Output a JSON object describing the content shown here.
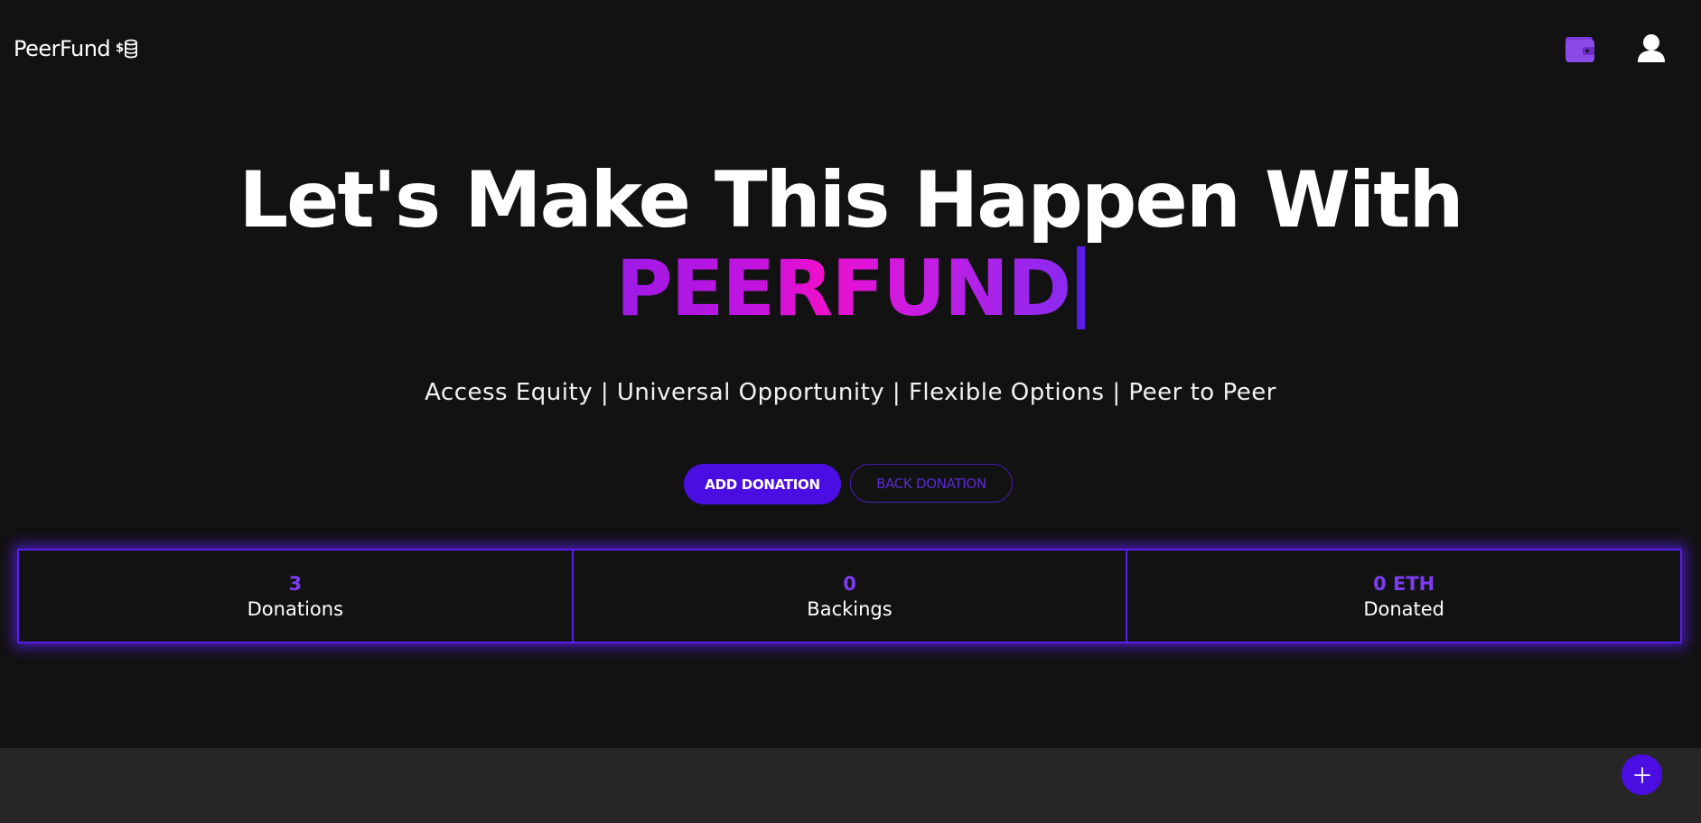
{
  "header": {
    "brand": "PeerFund",
    "brand_icon": "coins-icon",
    "wallet_icon": "wallet-icon",
    "user_icon": "user-icon"
  },
  "hero": {
    "title": "Let's Make This Happen With",
    "brand_text": "PEERFUND",
    "tagline": "Access Equity | Universal Opportunity | Flexible Options | Peer to Peer"
  },
  "actions": {
    "add_label": "ADD DONATION",
    "back_label": "BACK DONATION"
  },
  "stats": [
    {
      "value": "3",
      "label": "Donations"
    },
    {
      "value": "0",
      "label": "Backings"
    },
    {
      "value": "0 ETH",
      "label": "Donated"
    }
  ],
  "fab": {
    "icon": "plus-icon"
  },
  "colors": {
    "accent": "#4a0ee3",
    "accent_light": "#7d3cf0",
    "background": "#121212",
    "footer": "#262626"
  }
}
